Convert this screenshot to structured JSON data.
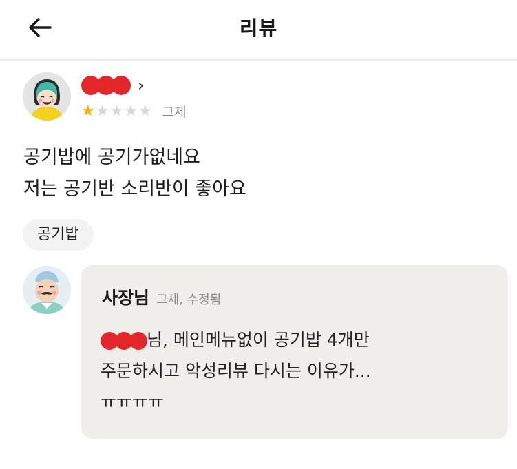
{
  "header": {
    "title": "리뷰",
    "back_icon": "arrow-left-icon"
  },
  "review": {
    "author_redacted": true,
    "rating": 1,
    "rating_max": 5,
    "date": "그제",
    "text_lines": [
      "공기밥에 공기가없네요",
      "저는 공기반 소리반이 좋아요"
    ],
    "tag": "공기밥"
  },
  "reply": {
    "author": "사장님",
    "meta": "그제, 수정됨",
    "line1_suffix": "님, 메인메뉴없이 공기밥 4개만",
    "line2": "주문하시고 악성리뷰 다시는 이유가...",
    "line3": "ㅠㅠㅠㅠ"
  },
  "colors": {
    "star_on": "#f4b400",
    "star_off": "#d6d6d6",
    "redaction": "#e3262a",
    "reply_bg": "#f0eeeb",
    "tag_bg": "#f3f3f3"
  }
}
